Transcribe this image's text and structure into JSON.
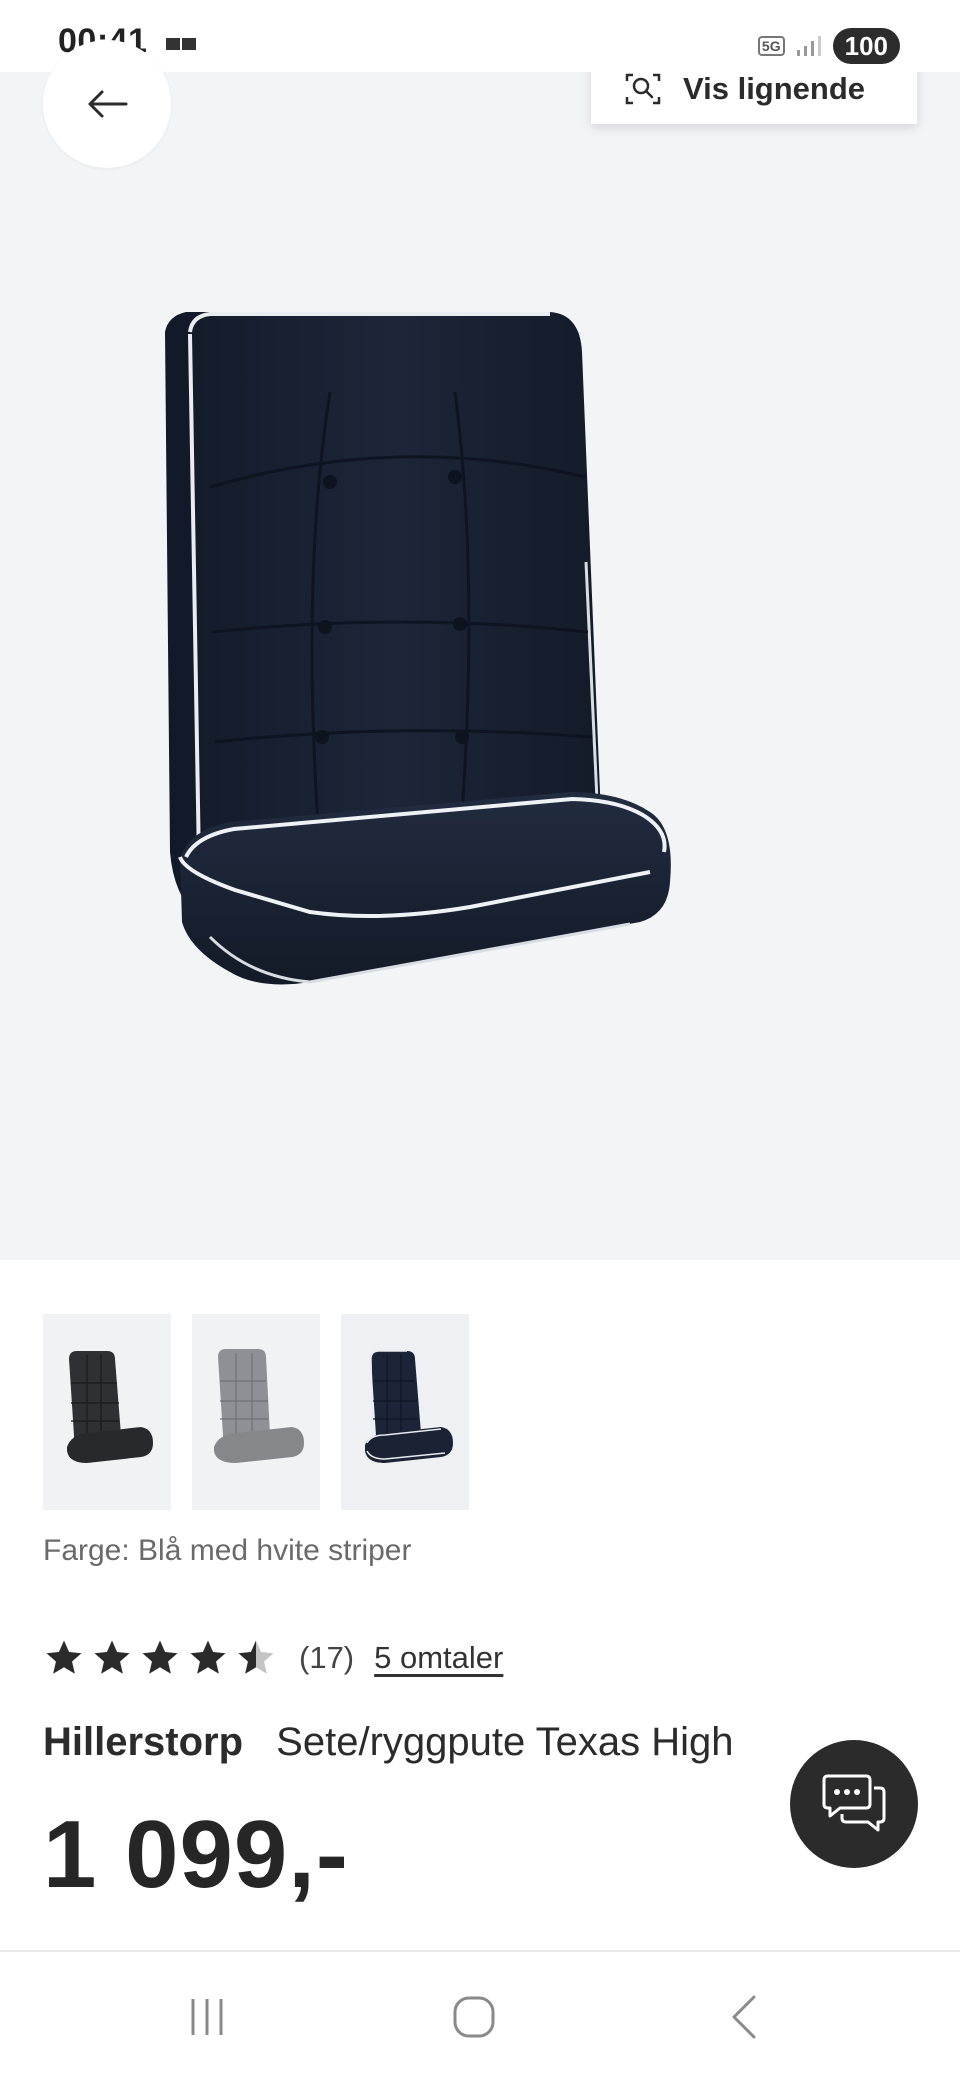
{
  "status_bar": {
    "time": "00:41",
    "network": "5G",
    "battery": "100"
  },
  "top_actions": {
    "similar_label": "Vis lignende"
  },
  "product": {
    "color_label": "Farge: Blå med hvite striper",
    "rating": 4.5,
    "rating_count": "(17)",
    "reviews_link": "5 omtaler",
    "brand": "Hillerstorp",
    "name": "Sete/ryggpute Texas High",
    "price": "1 099,-"
  },
  "thumbnails": [
    {
      "name": "black-cushion"
    },
    {
      "name": "grey-cushion"
    },
    {
      "name": "navy-cushion-white-piping",
      "selected": true
    }
  ],
  "colors": {
    "navy": "#1b2537",
    "black": "#2a2b2e",
    "grey": "#8c8e92",
    "dark_ui": "#2b2b2b"
  }
}
